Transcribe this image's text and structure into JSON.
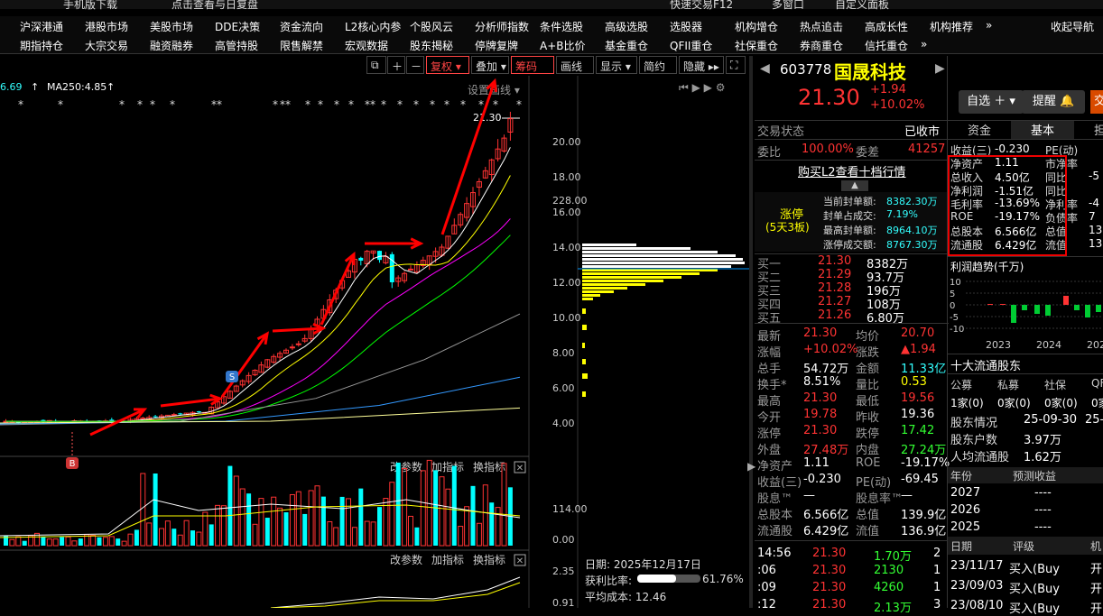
{
  "topstrip": {
    "item1": "手机版下载",
    "item2": "点击查看与日复盘",
    "item3": "快速交易F12",
    "item4": "多窗口",
    "item5": "自定义面板"
  },
  "menu1": [
    "沪深港通",
    "港股市场",
    "美股市场",
    "DDE决策",
    "资金流向",
    "L2核心内参",
    "个股风云",
    "分析师指数",
    "条件选股",
    "高级选股",
    "选股器",
    "机构增仓",
    "热点追击",
    "高成长性",
    "机构推荐",
    "»",
    "收起导航"
  ],
  "menu2": [
    "期指持仓",
    "大宗交易",
    "融资融券",
    "高管持股",
    "限售解禁",
    "宏观数据",
    "股东揭秘",
    "停牌复牌",
    "A+B比价",
    "基金重仓",
    "QFII重仓",
    "社保重仓",
    "券商重仓",
    "信托重仓",
    "»"
  ],
  "chart_toolbar": {
    "fuquan": "复权",
    "diejia": "叠加",
    "chouma": "筹码",
    "huaxian": "画线",
    "xianshi": "显示",
    "jianyue": "简约",
    "yincang": "隐藏",
    "settings": "设置画线"
  },
  "ma_row": {
    "ma_prev": "6.69",
    "ma250_label": "MA250:4.85"
  },
  "chart_data": {
    "type": "candlestick",
    "y_ticks": [
      "20.00",
      "18.00",
      "16.00",
      "14.00",
      "12.00",
      "10.00",
      "8.00",
      "6.00",
      "4.00"
    ],
    "last_price_label": "21.30",
    "vol_ticks": [
      "228.00",
      "114.00",
      "0.00"
    ],
    "macd_ticks": [
      "2.35",
      "0.91"
    ],
    "buy_marker": "B",
    "sell_marker": "S",
    "sub_tabs": [
      "改参数",
      "加指标",
      "换指标"
    ],
    "close_glyph": "✕"
  },
  "chip_panel": {
    "date_label": "日期: 2025年12月17日",
    "profit_label": "获利比率:",
    "profit_value": "61.76%",
    "profit_ratio": 0.6176,
    "avg_cost": "平均成本: 12.46"
  },
  "stock": {
    "code": "603778",
    "name": "国晟科技",
    "price": "21.30",
    "change": "+1.94",
    "pct": "+10.02%",
    "zixuan": "自选",
    "tixing": "提醒",
    "jiao": "交"
  },
  "quote": {
    "status_label": "交易状态",
    "status_value": "已收市",
    "weibi_label": "委比",
    "weibi_value": "100.00%",
    "weicha_label": "委差",
    "weicha_value": "41257",
    "l2_link": "购买L2查看十档行情",
    "zt_title": "涨停",
    "zt_sub": "(5天3板)",
    "zt_rows": [
      {
        "k": "当前封单额:",
        "v": "8382.30万"
      },
      {
        "k": "封单占成交:",
        "v": "7.19%"
      },
      {
        "k": "最高封单额:",
        "v": "8964.10万"
      },
      {
        "k": "涨停成交额:",
        "v": "8767.30万"
      }
    ],
    "buys": [
      {
        "k": "买一",
        "p": "21.30",
        "v": "8382万"
      },
      {
        "k": "买二",
        "p": "21.29",
        "v": "93.7万"
      },
      {
        "k": "买三",
        "p": "21.28",
        "v": "196万"
      },
      {
        "k": "买四",
        "p": "21.27",
        "v": "108万"
      },
      {
        "k": "买五",
        "p": "21.26",
        "v": "6.80万"
      }
    ],
    "stats": [
      {
        "k1": "最新",
        "v1": "21.30",
        "c1": "red",
        "k2": "均价",
        "v2": "20.70",
        "c2": "red"
      },
      {
        "k1": "涨幅",
        "v1": "+10.02%",
        "c1": "red",
        "k2": "涨跌",
        "v2": "▲1.94",
        "c2": "red"
      },
      {
        "k1": "总手",
        "v1": "54.72万",
        "c1": "wht",
        "k2": "金额",
        "v2": "11.33亿",
        "c2": "cyan"
      },
      {
        "k1": "换手*",
        "v1": "8.51%",
        "c1": "wht",
        "k2": "量比",
        "v2": "0.53",
        "c2": "yel"
      },
      {
        "k1": "最高",
        "v1": "21.30",
        "c1": "red",
        "k2": "最低",
        "v2": "19.56",
        "c2": "red"
      },
      {
        "k1": "今开",
        "v1": "19.78",
        "c1": "red",
        "k2": "昨收",
        "v2": "19.36",
        "c2": "wht"
      },
      {
        "k1": "涨停",
        "v1": "21.30",
        "c1": "red",
        "k2": "跌停",
        "v2": "17.42",
        "c2": "grn"
      },
      {
        "k1": "外盘",
        "v1": "27.48万",
        "c1": "red",
        "k2": "内盘",
        "v2": "27.24万",
        "c2": "grn"
      },
      {
        "k1": "净资产",
        "v1": "1.11",
        "c1": "wht",
        "k2": "ROE",
        "v2": "-19.17%",
        "c2": "wht"
      },
      {
        "k1": "收益(三)",
        "v1": "-0.230",
        "c1": "wht",
        "k2": "PE(动)",
        "v2": "-69.45",
        "c2": "wht"
      },
      {
        "k1": "股息™",
        "v1": "—",
        "c1": "wht",
        "k2": "股息率™",
        "v2": "—",
        "c2": "wht"
      },
      {
        "k1": "总股本",
        "v1": "6.566亿",
        "c1": "wht",
        "k2": "总值",
        "v2": "139.9亿",
        "c2": "wht"
      },
      {
        "k1": "流通股",
        "v1": "6.429亿",
        "c1": "wht",
        "k2": "流值",
        "v2": "136.9亿",
        "c2": "wht"
      }
    ],
    "ticks": [
      {
        "t": "14:56",
        "p": "21.30",
        "v": "1.70万",
        "n": "2"
      },
      {
        "t": ":06",
        "p": "21.30",
        "v": "2130",
        "n": "1"
      },
      {
        "t": ":09",
        "p": "21.30",
        "v": "4260",
        "n": "1"
      },
      {
        "t": ":12",
        "p": "21.30",
        "v": "2.13万",
        "n": "3"
      }
    ]
  },
  "f10": {
    "tabs": [
      "资金",
      "基本",
      "担"
    ],
    "rows": [
      {
        "k": "收益(三)",
        "v": "-0.230",
        "k2": "PE(动)",
        "v2": ""
      },
      {
        "k": "净资产",
        "v": "1.11",
        "k2": "市净率",
        "v2": ""
      },
      {
        "k": "总收入",
        "v": "4.50亿",
        "k2": "同比",
        "v2": "-5"
      },
      {
        "k": "净利润",
        "v": "-1.51亿",
        "k2": "同比",
        "v2": ""
      },
      {
        "k": "毛利率",
        "v": "-13.69%",
        "k2": "净利率",
        "v2": "-4"
      },
      {
        "k": "ROE",
        "v": "-19.17%",
        "k2": "负债率",
        "v2": "7"
      },
      {
        "k": "总股本",
        "v": "6.566亿",
        "k2": "总值",
        "v2": "13"
      },
      {
        "k": "流通股",
        "v": "6.429亿",
        "k2": "流值",
        "v2": "13"
      }
    ],
    "profit_title": "利润趋势(千万)",
    "profit_y": [
      "10",
      "5",
      "0",
      "-5",
      "-10"
    ],
    "profit_years": [
      "2023",
      "2024",
      "202"
    ],
    "holders_title": "十大流通股东",
    "holders_head": [
      "公募",
      "私募",
      "社保",
      "QFI"
    ],
    "holders_vals": [
      "1家(0)",
      "0家(0)",
      "0家(0)",
      "0家"
    ],
    "holder_rows": [
      {
        "k": "股东情况",
        "v": "25-09-30",
        "v2": "25-"
      },
      {
        "k": "股东户数",
        "v": "3.97万",
        "v2": ""
      },
      {
        "k": "人均流通股",
        "v": "1.62万",
        "v2": ""
      }
    ],
    "forecast_head": [
      "年份",
      "预测收益"
    ],
    "forecast": [
      {
        "y": "2027",
        "v": "----"
      },
      {
        "y": "2026",
        "v": "----"
      },
      {
        "y": "2025",
        "v": "----"
      }
    ],
    "rating_head": [
      "日期",
      "评级",
      "机"
    ],
    "ratings": [
      {
        "d": "23/11/17",
        "r": "买入(Buy",
        "o": "开"
      },
      {
        "d": "23/09/03",
        "r": "买入(Buy",
        "o": "开"
      },
      {
        "d": "23/08/10",
        "r": "买入(Buy",
        "o": "开"
      }
    ]
  },
  "colors": {
    "up": "#ff3333",
    "down": "#00ffff",
    "ma5": "#ffffff",
    "ma10": "#ffff00",
    "ma20": "#ff00ff",
    "ma30": "#00ff00",
    "ma60": "#999999",
    "ma120": "#3399ff",
    "ma250": "#ffff99",
    "annot": "#ff0000"
  }
}
